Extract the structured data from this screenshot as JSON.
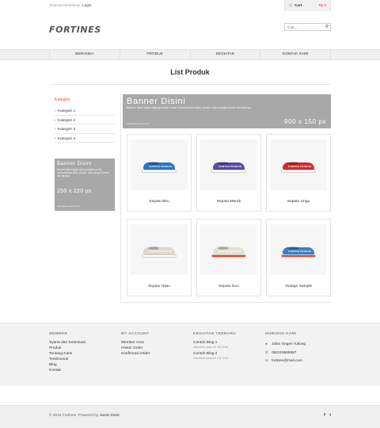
{
  "topbar": {
    "welcome": "Selamat berbelanja,",
    "login": "Login",
    "cart_label": "Cart",
    "cart_total": "Rp 0"
  },
  "header": {
    "logo": "FORTINES",
    "search_placeholder": "Cari..."
  },
  "nav": {
    "items": [
      "BERANDA",
      "PRODUK",
      "KEGIATAN",
      "KONTAK KAMI"
    ]
  },
  "page": {
    "title": "List Produk"
  },
  "sidebar": {
    "heading": "Kategori",
    "items": [
      "Kategori 1",
      "Kategori 2",
      "Kategori 3",
      "Kategori 4"
    ],
    "banner": {
      "title": "Banner Disini",
      "text": "Banner disini dapat dipergunakan untuk menampilkan iklan, promo, atau pengumuman lain-lainnya.",
      "size": "250 x 220 px",
      "url": "www.jarvis-store.com"
    }
  },
  "banner": {
    "title": "Banner Disini",
    "text": "Banner disini dapat dipergunakan untuk menampilkan iklan, promo, atau pengumuman lain-lainnya.",
    "size": "900 x 150 px",
    "url": "www.jarvis-store.com"
  },
  "products": [
    {
      "name": "Sepatu Biru",
      "upper": "#2e72c4",
      "sole": "#ffffff"
    },
    {
      "name": "Sepatu Merah",
      "upper": "#5a4aa0",
      "sole": "#ffffff"
    },
    {
      "name": "Sepatu Ungu",
      "upper": "#d42a2f",
      "sole": "#ffffff"
    },
    {
      "name": "Sepatu Hijau",
      "upper": "#ddd8c8",
      "sole": "#ffffff"
    },
    {
      "name": "Sepatu Duo",
      "upper": "#e6e0d2",
      "sole": "#e8452c"
    },
    {
      "name": "Vintage Sample",
      "upper": "#3b7ec8",
      "sole": "#e8452c"
    }
  ],
  "product_brand": "CONTOH PRODUK",
  "footer": {
    "member": {
      "heading": "MEMBER",
      "links": [
        "Syarat dan Ketentuan",
        "Produk",
        "Tentang Kami",
        "Testimonial",
        "Blog",
        "Kontak"
      ]
    },
    "account": {
      "heading": "MY ACCOUNT",
      "links": [
        "Member Area",
        "Histori Order",
        "Konfirmasi Order"
      ]
    },
    "news": {
      "heading": "KEGIATAN TERBARU",
      "items": [
        {
          "title": "Contoh Blog 1",
          "date": "ditambah pada 26 Juli 2016"
        },
        {
          "title": "Contoh Blog 2",
          "date": "ditambah pada 26 Juli 2016"
        }
      ]
    },
    "contact": {
      "heading": "HUBUNGI KAMI",
      "address": "Jalan Gegerr Kalong",
      "phone": "082216655557",
      "email": "fortines@mail.com"
    }
  },
  "bottom": {
    "copyright": "© 2016 Fortines. Powered by",
    "powered_link": "Jarvis Store",
    "social": [
      "f",
      "t"
    ]
  }
}
